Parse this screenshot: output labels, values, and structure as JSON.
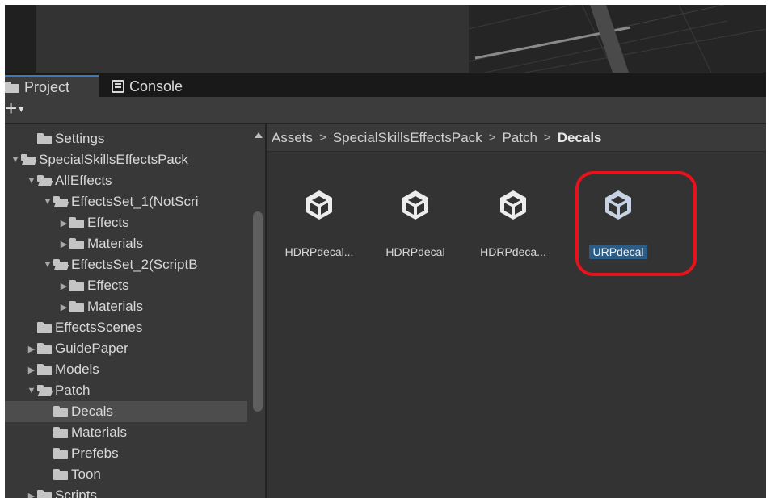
{
  "tabs": [
    {
      "label": "Project",
      "icon": "folder-icon",
      "active": true
    },
    {
      "label": "Console",
      "icon": "console-icon",
      "active": false
    }
  ],
  "toolbar": {
    "add_label": "+",
    "add_caret": "▾"
  },
  "tree": [
    {
      "label": "Settings",
      "depth": 1,
      "expander": "none",
      "open": false
    },
    {
      "label": "SpecialSkillsEffectsPack",
      "depth": 0,
      "expander": "open",
      "open": true
    },
    {
      "label": "AllEffects",
      "depth": 1,
      "expander": "open",
      "open": true
    },
    {
      "label": "EffectsSet_1(NotScri",
      "depth": 2,
      "expander": "open",
      "open": true
    },
    {
      "label": "Effects",
      "depth": 3,
      "expander": "closed",
      "open": false
    },
    {
      "label": "Materials",
      "depth": 3,
      "expander": "closed",
      "open": false
    },
    {
      "label": "EffectsSet_2(ScriptB",
      "depth": 2,
      "expander": "open",
      "open": true
    },
    {
      "label": "Effects",
      "depth": 3,
      "expander": "closed",
      "open": false
    },
    {
      "label": "Materials",
      "depth": 3,
      "expander": "closed",
      "open": false
    },
    {
      "label": "EffectsScenes",
      "depth": 1,
      "expander": "none",
      "open": false
    },
    {
      "label": "GuidePaper",
      "depth": 1,
      "expander": "closed",
      "open": false
    },
    {
      "label": "Models",
      "depth": 1,
      "expander": "closed",
      "open": false
    },
    {
      "label": "Patch",
      "depth": 1,
      "expander": "open",
      "open": true
    },
    {
      "label": "Decals",
      "depth": 2,
      "expander": "none",
      "open": false,
      "selected": true
    },
    {
      "label": "Materials",
      "depth": 2,
      "expander": "none",
      "open": false
    },
    {
      "label": "Prefebs",
      "depth": 2,
      "expander": "none",
      "open": false
    },
    {
      "label": "Toon",
      "depth": 2,
      "expander": "none",
      "open": false
    },
    {
      "label": "Scripts",
      "depth": 1,
      "expander": "closed",
      "open": false
    }
  ],
  "breadcrumb": [
    "Assets",
    "SpecialSkillsEffectsPack",
    "Patch",
    "Decals"
  ],
  "breadcrumb_separator": ">",
  "assets": [
    {
      "label": "HDRPdecal...",
      "icon": "unity-cube-icon",
      "selected": false
    },
    {
      "label": "HDRPdecal",
      "icon": "unity-cube-icon",
      "selected": false
    },
    {
      "label": "HDRPdeca...",
      "icon": "unity-cube-icon",
      "selected": false
    },
    {
      "label": "URPdecal",
      "icon": "unity-cube-icon",
      "selected": true
    }
  ],
  "colors": {
    "selection": "#2c5d87",
    "highlight_ring": "#e8121d",
    "tab_accent": "#3a79bb"
  }
}
